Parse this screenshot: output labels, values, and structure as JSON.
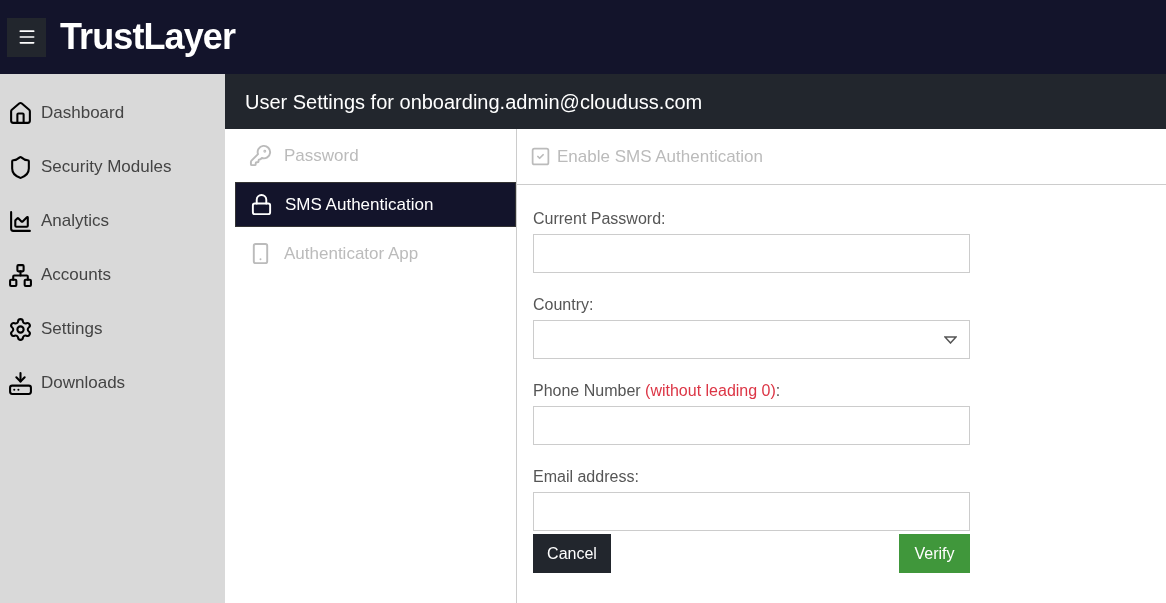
{
  "header": {
    "logo": "TrustLayer"
  },
  "sidebar": {
    "items": [
      {
        "label": "Dashboard"
      },
      {
        "label": "Security Modules"
      },
      {
        "label": "Analytics"
      },
      {
        "label": "Accounts"
      },
      {
        "label": "Settings"
      },
      {
        "label": "Downloads"
      }
    ]
  },
  "page_title": "User Settings for onboarding.admin@clouduss.com",
  "tabs": [
    {
      "label": "Password",
      "selected": false
    },
    {
      "label": "SMS Authentication",
      "selected": true
    },
    {
      "label": "Authenticator App",
      "selected": false
    }
  ],
  "enable_checkbox": {
    "label": "Enable SMS Authentication",
    "checked": true,
    "disabled": true
  },
  "fields": [
    {
      "kind": "text",
      "label": "Current Password:"
    },
    {
      "kind": "select",
      "label": "Country:"
    },
    {
      "kind": "text",
      "label": "Phone Number",
      "hint": "(without leading 0)",
      "suffix": ":"
    },
    {
      "kind": "text",
      "label": "Email address:"
    }
  ],
  "buttons": {
    "cancel": "Cancel",
    "verify": "Verify"
  }
}
